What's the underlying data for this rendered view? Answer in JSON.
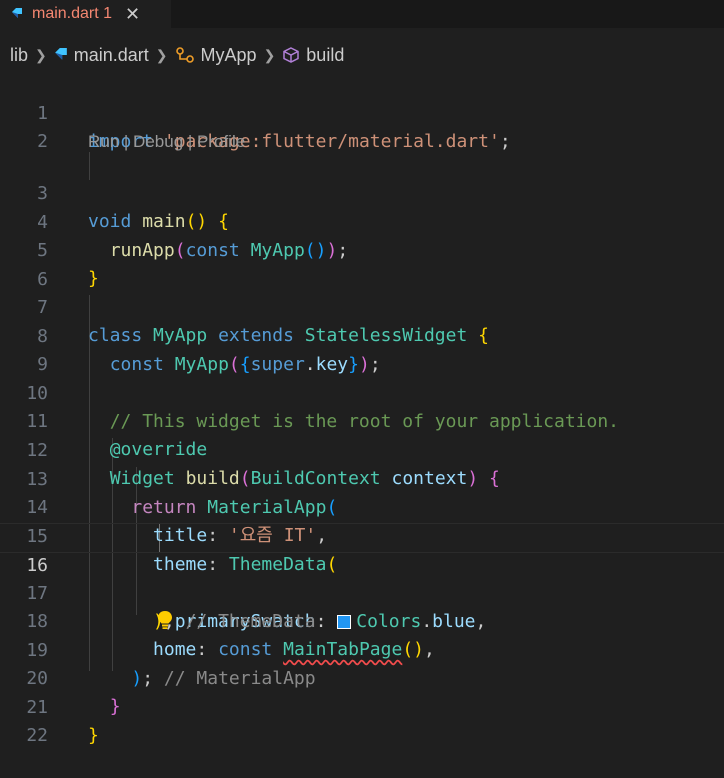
{
  "tab": {
    "label": "main.dart 1",
    "close": "✕",
    "label_color": "#f48771"
  },
  "breadcrumb": {
    "items": [
      "lib",
      "main.dart",
      "MyApp",
      "build"
    ]
  },
  "codelens": "Run | Debug | Profile",
  "active_line": 16,
  "lines": [
    {
      "n": "1"
    },
    {
      "n": "2"
    },
    {
      "n": "3"
    },
    {
      "n": "4"
    },
    {
      "n": "5"
    },
    {
      "n": "6"
    },
    {
      "n": "7"
    },
    {
      "n": "8"
    },
    {
      "n": "9"
    },
    {
      "n": "10"
    },
    {
      "n": "11"
    },
    {
      "n": "12"
    },
    {
      "n": "13"
    },
    {
      "n": "14"
    },
    {
      "n": "15"
    },
    {
      "n": "16"
    },
    {
      "n": "17"
    },
    {
      "n": "18"
    },
    {
      "n": "19"
    },
    {
      "n": "20"
    },
    {
      "n": "21"
    },
    {
      "n": "22"
    }
  ],
  "tokens": {
    "import": "import",
    "import_path": "'package:flutter/material.dart'",
    "semi": ";",
    "void": "void",
    "main": "main",
    "run_app": "runApp",
    "const": "const",
    "myapp": "MyApp",
    "class": "class",
    "extends": "extends",
    "stateless": "StatelessWidget",
    "super": "super",
    "key": "key",
    "comment": "// This widget is the root of your application.",
    "override": "@override",
    "widget": "Widget",
    "build": "build",
    "build_context": "BuildContext",
    "context": "context",
    "return": "return",
    "material_app": "MaterialApp",
    "title": "title",
    "title_value": "'요즘 IT'",
    "theme": "theme",
    "theme_data": "ThemeData",
    "primary_swatch": "primarySwatch",
    "colors": "Colors",
    "blue": "blue",
    "themedata_hint": "// ThemeData",
    "home": "home",
    "main_tab_page": "MainTabPage",
    "materialapp_hint": "// MaterialApp"
  },
  "colors": {
    "swatch": "#2196f3",
    "error": "#f14c4c"
  }
}
